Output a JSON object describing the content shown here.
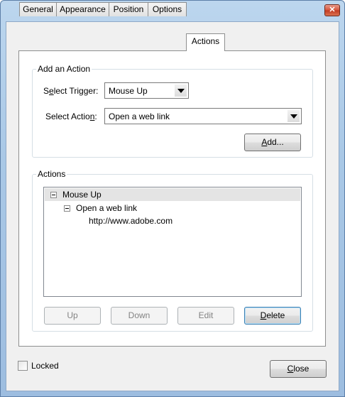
{
  "window": {
    "close_glyph": "✕"
  },
  "tabs": [
    "General",
    "Appearance",
    "Position",
    "Options",
    "Actions"
  ],
  "add_action": {
    "group_label": "Add an Action",
    "trigger_label_pre": "S",
    "trigger_label_u": "e",
    "trigger_label_post": "lect Trigger:",
    "trigger_value": "Mouse Up",
    "action_label_pre": "Select Actio",
    "action_label_u": "n",
    "action_label_post": ":",
    "action_value": "Open a web link",
    "add_u": "A",
    "add_rest": "dd..."
  },
  "actions": {
    "group_label": "Actions",
    "tree": {
      "trigger": "Mouse Up",
      "action": "Open a web link",
      "url": "http://www.adobe.com"
    },
    "buttons": {
      "up": "Up",
      "down": "Down",
      "edit": "Edit",
      "delete_u": "D",
      "delete_rest": "elete"
    }
  },
  "locked_label": "Locked",
  "close_u": "C",
  "close_rest": "lose"
}
